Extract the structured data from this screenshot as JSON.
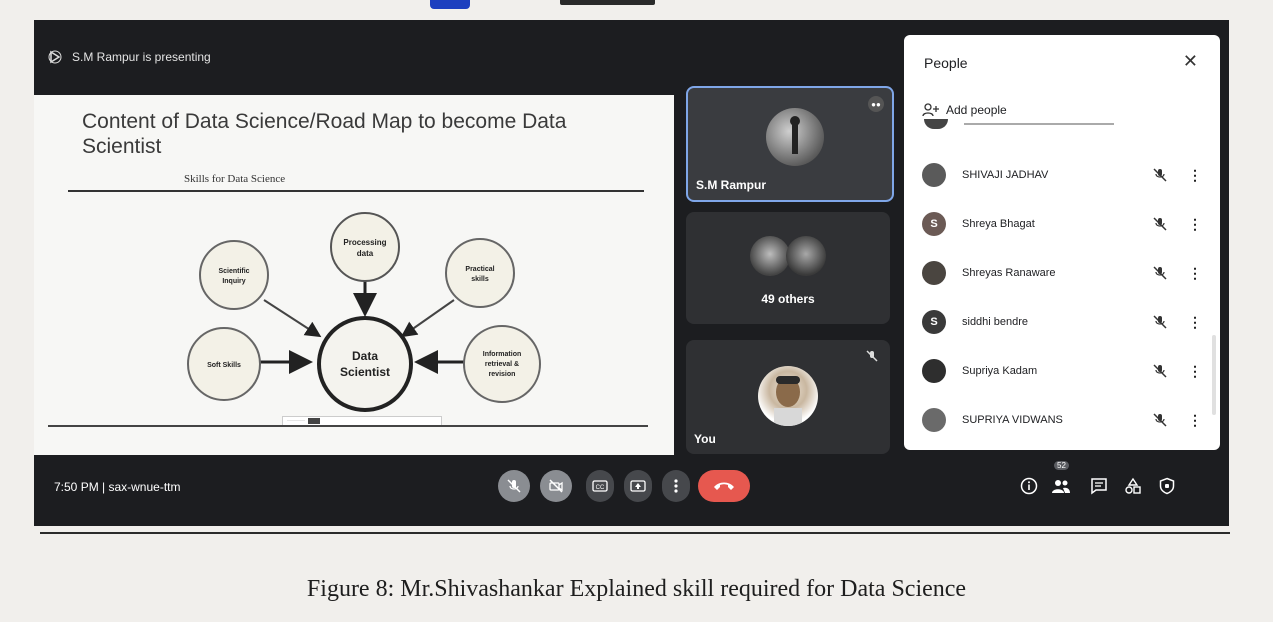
{
  "meeting": {
    "presenting_text": "S.M Rampur is presenting",
    "time_code": "7:50 PM | sax-wnue-ttm"
  },
  "slide": {
    "title": "Content of Data Science/Road Map to become Data Scientist",
    "subtitle": "Skills for Data Science",
    "nodes": {
      "center": [
        "Data",
        "Scientist"
      ],
      "processing": [
        "Processing",
        "data"
      ],
      "scientific": [
        "Scientific",
        "Inquiry"
      ],
      "practical": [
        "Practical",
        "skills"
      ],
      "soft": [
        "Soft Skills"
      ],
      "information": [
        "Information",
        "retrieval &",
        "revision"
      ]
    }
  },
  "tiles": [
    {
      "name": "S.M Rampur"
    },
    {
      "name": "49 others"
    },
    {
      "name": "You"
    }
  ],
  "people_panel": {
    "title": "People",
    "add_label": "Add people",
    "participants": [
      {
        "name": "SHIVAJI JADHAV",
        "avatar": "photo",
        "color": "#5a5a5a"
      },
      {
        "name": "Shreya Bhagat",
        "avatar": "S",
        "color": "#6b5a55"
      },
      {
        "name": "Shreyas Ranaware",
        "avatar": "photo",
        "color": "#4a4540"
      },
      {
        "name": "siddhi bendre",
        "avatar": "S",
        "color": "#3a3a3a"
      },
      {
        "name": "Supriya Kadam",
        "avatar": "photo",
        "color": "#2e2e2e"
      },
      {
        "name": "SUPRIYA VIDWANS",
        "avatar": "photo",
        "color": "#6a6a6a"
      }
    ]
  },
  "toolbar": {
    "participant_count": "52"
  },
  "caption": "Figure 8: Mr.Shivashankar Explained skill required for Data Science"
}
